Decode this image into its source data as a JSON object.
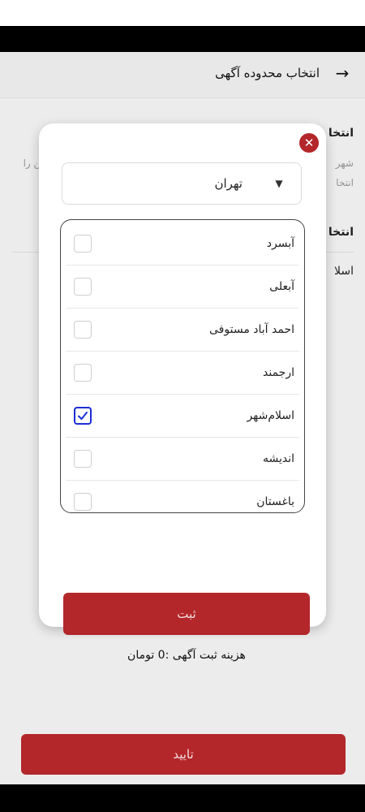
{
  "header": {
    "title": "انتخاب محدوده آگهی",
    "back_icon": "arrow-right-icon"
  },
  "background": {
    "section1_title": "انتخا",
    "section1_sub1": "شهر",
    "section1_sub2": "انتخا",
    "section1_left": "ین را",
    "section2_title": "انتخا",
    "selected_value": "اسلا"
  },
  "modal": {
    "close_icon": "close-icon",
    "city_select": {
      "value": "تهران",
      "caret_icon": "caret-down-icon"
    },
    "items": [
      {
        "label": "آبسرد",
        "checked": false
      },
      {
        "label": "آبعلی",
        "checked": false
      },
      {
        "label": "احمد آباد مستوفی",
        "checked": false
      },
      {
        "label": "ارجمند",
        "checked": false
      },
      {
        "label": "اسلام‌شهر",
        "checked": true
      },
      {
        "label": "اندیشه",
        "checked": false
      },
      {
        "label": "باغستان",
        "checked": false
      }
    ],
    "submit_label": "ثبت",
    "cost_text": "هزینه ثبت آگهی :0 تومان"
  },
  "footer": {
    "confirm_label": "تایید"
  },
  "colors": {
    "accent": "#b3262a",
    "checkbox_checked": "#1b2fd6"
  }
}
